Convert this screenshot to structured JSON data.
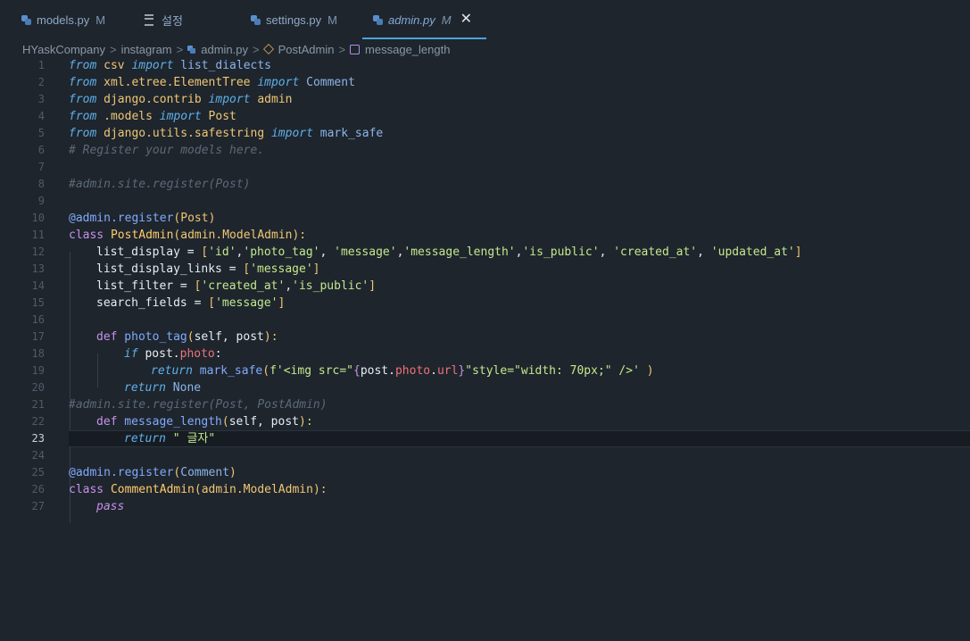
{
  "tabs": [
    {
      "label": "models.py",
      "status": "M",
      "icon": "python-icon"
    },
    {
      "label": "설정",
      "status": "",
      "icon": "settings-icon"
    },
    {
      "label": "settings.py",
      "status": "M",
      "icon": "python-icon"
    },
    {
      "label": "admin.py",
      "status": "M",
      "icon": "python-icon",
      "active": true,
      "close": "✕"
    }
  ],
  "breadcrumb": {
    "items": [
      "HYaskCompany",
      "instagram",
      "admin.py",
      "PostAdmin",
      "message_length"
    ],
    "separator": ">"
  },
  "editor": {
    "current_line": 23,
    "line_numbers": [
      "1",
      "2",
      "3",
      "4",
      "5",
      "6",
      "7",
      "8",
      "9",
      "10",
      "11",
      "12",
      "13",
      "14",
      "15",
      "16",
      "17",
      "18",
      "19",
      "20",
      "21",
      "22",
      "23",
      "24",
      "25",
      "26",
      "27"
    ]
  },
  "code": {
    "l1": [
      "from",
      " csv ",
      "import",
      " list_dialects"
    ],
    "l2": [
      "from",
      " xml.etree.ElementTree ",
      "import",
      " Comment"
    ],
    "l3": [
      "from",
      " django.contrib ",
      "import",
      " admin"
    ],
    "l4": [
      "from",
      " .models ",
      "import",
      " Post"
    ],
    "l5": [
      "from",
      " django.utils.safestring ",
      "import",
      " mark_safe"
    ],
    "l6": "# Register your models here.",
    "l8": "#admin.site.register(Post)",
    "l10": [
      "@admin.",
      "register",
      "(",
      "Post",
      ")"
    ],
    "l11": [
      "class",
      " PostAdmin",
      "(admin.ModelAdmin):"
    ],
    "l12": [
      "list_display = ",
      "[",
      "'id'",
      ",",
      "'photo_tag'",
      ", ",
      "'message'",
      ",",
      "'message_length'",
      ",",
      "'is_public'",
      ", ",
      "'created_at'",
      ", ",
      "'updated_at'",
      "]"
    ],
    "l13": [
      "list_display_links = ",
      "[",
      "'message'",
      "]"
    ],
    "l14": [
      "list_filter = ",
      "[",
      "'created_at'",
      ",",
      "'is_public'",
      "]"
    ],
    "l15": [
      "search_fields = ",
      "[",
      "'message'",
      "]"
    ],
    "l17": [
      "def",
      " photo_tag",
      "(",
      "self, post",
      "):"
    ],
    "l18": [
      "if",
      " post.",
      "photo",
      ":"
    ],
    "l19": [
      "return",
      " mark_safe",
      "(",
      "f'<img src=\"",
      "{",
      "post.",
      "photo",
      ".",
      "url",
      "}",
      "\"style=\"width: 70px;\" />'",
      " )"
    ],
    "l20": [
      "return",
      " None"
    ],
    "l21": "#admin.site.register(Post, PostAdmin)",
    "l22": [
      "def",
      " message_length",
      "(",
      "self, post",
      "):"
    ],
    "l23": [
      "return",
      " \" 글자\""
    ],
    "l25": [
      "@admin.",
      "register",
      "(",
      "Comment",
      ")"
    ],
    "l26": [
      "class",
      " CommentAdmin",
      "(admin.ModelAdmin):"
    ],
    "l27": "pass"
  },
  "colors": {
    "background": "#1e252d",
    "keyword": "#c792ea",
    "from_keyword": "#5fb0e8",
    "string": "#c3e88d",
    "comment": "#5d6977",
    "bracket": "#f0c674",
    "active_tab_underline": "#4da3d8"
  }
}
